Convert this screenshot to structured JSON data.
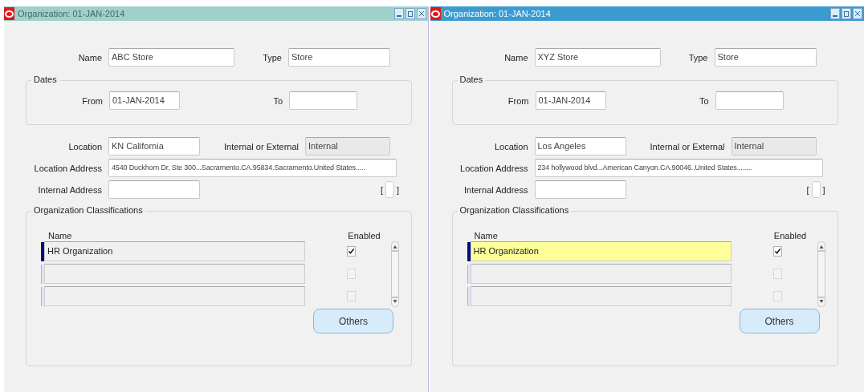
{
  "windows": [
    {
      "title": "Organization: 01-JAN-2014",
      "active": false,
      "name": {
        "label": "Name",
        "value": "ABC Store"
      },
      "type": {
        "label": "Type",
        "value": "Store"
      },
      "dates": {
        "legend": "Dates",
        "from": {
          "label": "From",
          "value": "01-JAN-2014"
        },
        "to": {
          "label": "To"
        }
      },
      "location": {
        "label": "Location",
        "value": "KN California"
      },
      "internal_or_external": {
        "label": "Internal or External",
        "value": "Internal",
        "disabled": true
      },
      "location_address": {
        "label": "Location Address",
        "value": "4540 Duckhorn Dr, Ste 300...Sacramento.CA.95834.Sacramento.United States....."
      },
      "internal_address": {
        "label": "Internal Address"
      },
      "context_field": {
        "open": "[",
        "close": "]"
      },
      "classifications": {
        "legend": "Organization Classifications",
        "name_header": "Name",
        "enabled_header": "Enabled",
        "rows": [
          {
            "name": "HR Organization",
            "enabled": true,
            "current": true,
            "selected": false
          },
          {
            "enabled": false,
            "current": false,
            "selected": false
          },
          {
            "enabled": false,
            "current": false,
            "selected": false
          }
        ],
        "others_button": "Others"
      }
    },
    {
      "title": "Organization: 01-JAN-2014",
      "active": true,
      "name": {
        "label": "Name",
        "value": "XYZ Store"
      },
      "type": {
        "label": "Type",
        "value": "Store"
      },
      "dates": {
        "legend": "Dates",
        "from": {
          "label": "From",
          "value": "01-JAN-2014"
        },
        "to": {
          "label": "To"
        }
      },
      "location": {
        "label": "Location",
        "value": "Los Angeles"
      },
      "internal_or_external": {
        "label": "Internal or External",
        "value": "Internal",
        "disabled": true
      },
      "location_address": {
        "label": "Location Address",
        "value": "234 hollywood blvd...American Canyon.CA.90046..United States........"
      },
      "internal_address": {
        "label": "Internal Address"
      },
      "context_field": {
        "open": "[",
        "close": "]"
      },
      "classifications": {
        "legend": "Organization Classifications",
        "name_header": "Name",
        "enabled_header": "Enabled",
        "rows": [
          {
            "name": "HR Organization",
            "enabled": true,
            "current": true,
            "selected": true
          },
          {
            "enabled": false,
            "current": false,
            "selected": false
          },
          {
            "enabled": false,
            "current": false,
            "selected": false
          }
        ],
        "others_button": "Others"
      }
    }
  ]
}
